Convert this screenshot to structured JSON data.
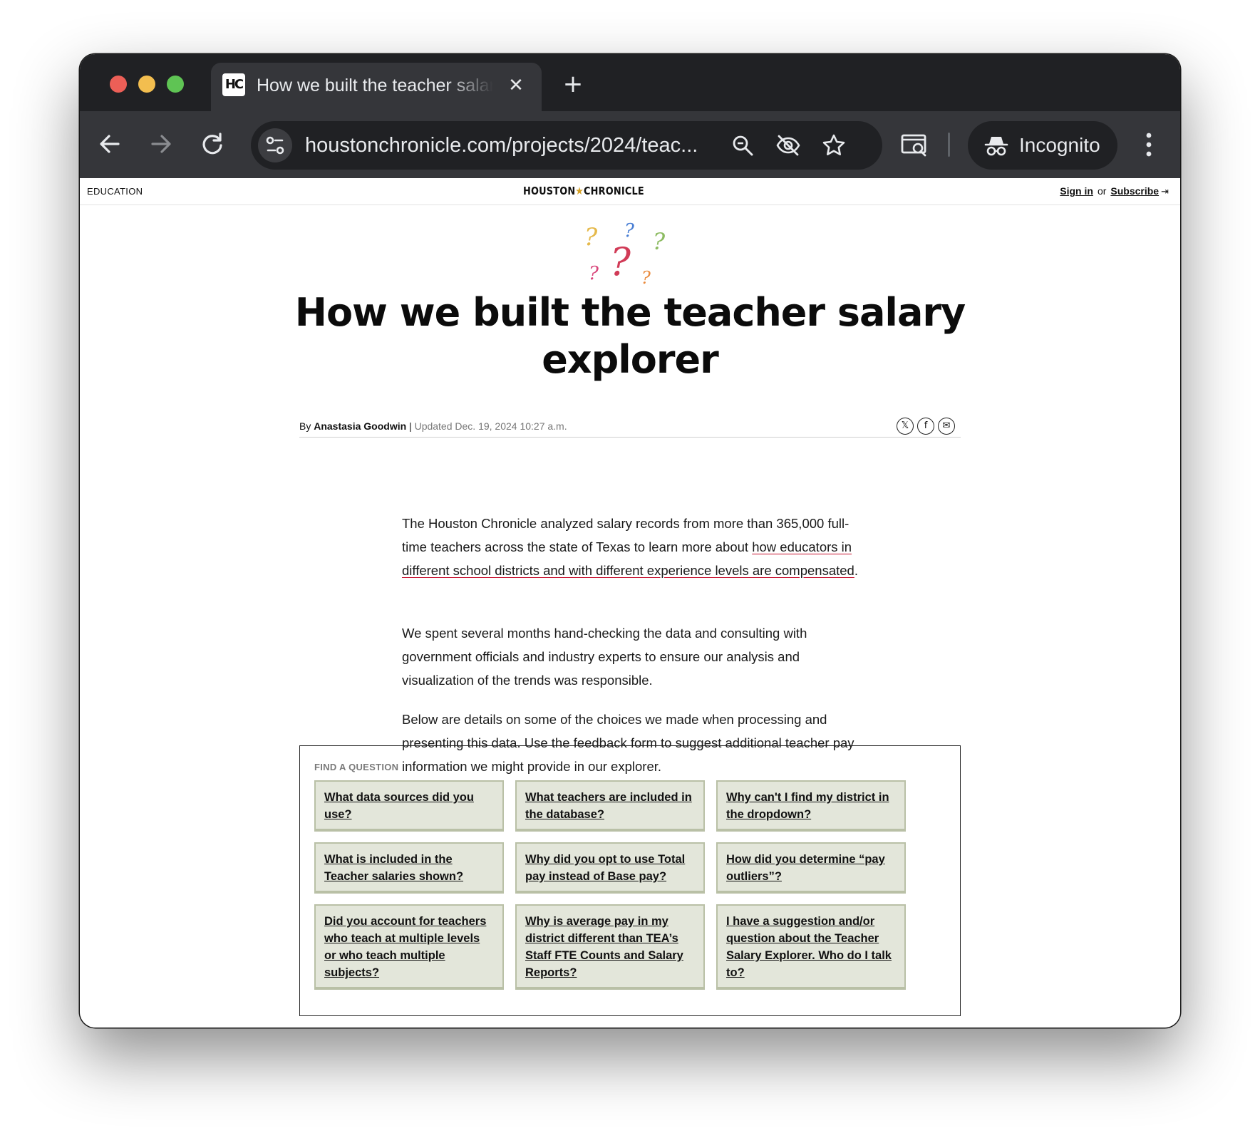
{
  "browser": {
    "tab_title": "How we built the teacher salary explorer",
    "tab_favicon": "HC",
    "tab_close": "✕",
    "new_tab": "+",
    "url": "houstonchronicle.com/projects/2024/teac...",
    "incognito_label": "Incognito",
    "icons": [
      "back-arrow-icon",
      "forward-arrow-icon",
      "reload-icon",
      "site-info-icon",
      "zoom-icon",
      "eye-off-icon",
      "star-icon",
      "tab-search-icon",
      "incognito-icon",
      "more-vert-icon"
    ]
  },
  "site_header": {
    "section": "EDUCATION",
    "logo_left": "HOUSTON",
    "logo_star": "★",
    "logo_right": "CHRONICLE",
    "sign_in": "Sign in",
    "or": "or",
    "subscribe": "Subscribe",
    "exit_icon": "⇥"
  },
  "article": {
    "headline": "How we built the teacher salary explorer",
    "byline_prefix": "By",
    "author": "Anastasia Goodwin",
    "separator": "|",
    "updated": "Updated Dec. 19, 2024 10:27 a.m.",
    "share": [
      "𝕏",
      "f",
      "✉"
    ],
    "p1_before": "The Houston Chronicle analyzed salary records from more than 365,000 full-time teachers across the state of Texas to learn more about ",
    "p1_link": "how educators in different school districts and with different experience levels are compensated",
    "p1_after": ".",
    "p2": "We spent several months hand-checking the data and consulting with government officials and industry experts to ensure our analysis and visualization of the trends was responsible.",
    "p3": "Below are details on some of the choices we made when processing and presenting this data. Use the feedback form to suggest additional teacher pay information we might provide in our explorer."
  },
  "faq": {
    "label": "FIND A QUESTION",
    "questions": [
      "What data sources did you use?",
      "What teachers are included in the database?",
      "Why can't I find my district in the dropdown?",
      "What is included in the Teacher salaries shown?",
      "Why did you opt to use Total pay instead of Base pay?",
      "How did you determine “pay outliers”?",
      "Did you account for teachers who teach at multiple levels or who teach multiple subjects?",
      "Why is average pay in my district different than TEA’s Staff FTE Counts and Salary Reports?",
      "I have a suggestion and/or question about the Teacher Salary Explorer. Who do I talk to?"
    ]
  },
  "colors": {
    "chrome_dark": "#202124",
    "chrome_toolbar": "#35363a",
    "card_bg": "#e3e6da",
    "card_border": "#b9c0a6",
    "link_underline": "#c8102e",
    "logo_star": "#d6a126"
  }
}
